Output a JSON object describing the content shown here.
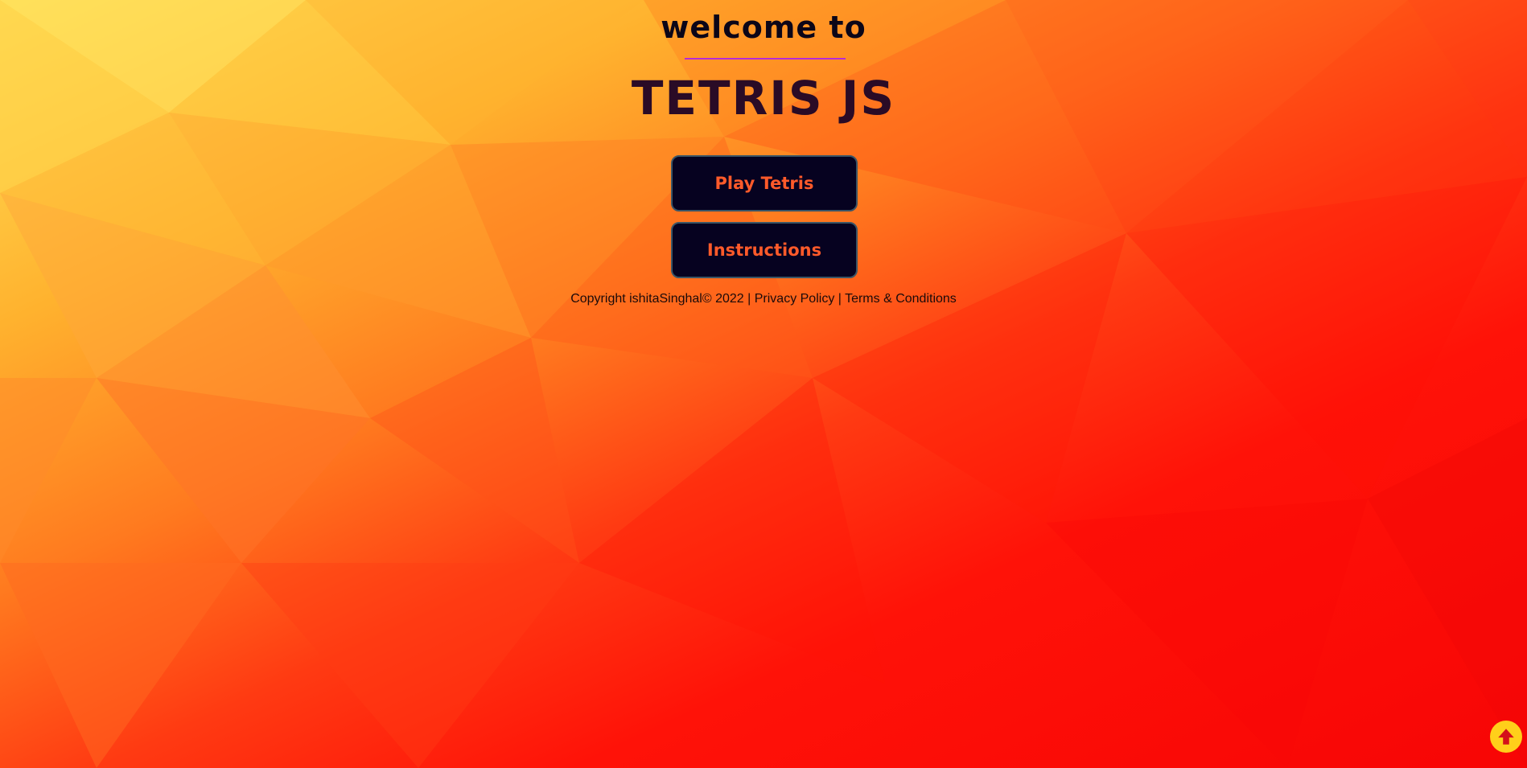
{
  "header": {
    "welcome": "welcome to",
    "title": "TETRIS JS"
  },
  "menu": {
    "play_label": "Play Tetris",
    "instructions_label": "Instructions"
  },
  "footer": {
    "copyright": "Copyright ishitaSinghal© 2022 |",
    "privacy": "Privacy Policy",
    "separator": "|",
    "terms": "Terms & Conditions"
  },
  "icons": {
    "scroll_top": "arrow-up-icon"
  },
  "colors": {
    "button_bg": "#060220",
    "button_text": "#ff5a2a",
    "accent_rule": "#b62ad6",
    "scroll_button": "#ffcf1a"
  }
}
